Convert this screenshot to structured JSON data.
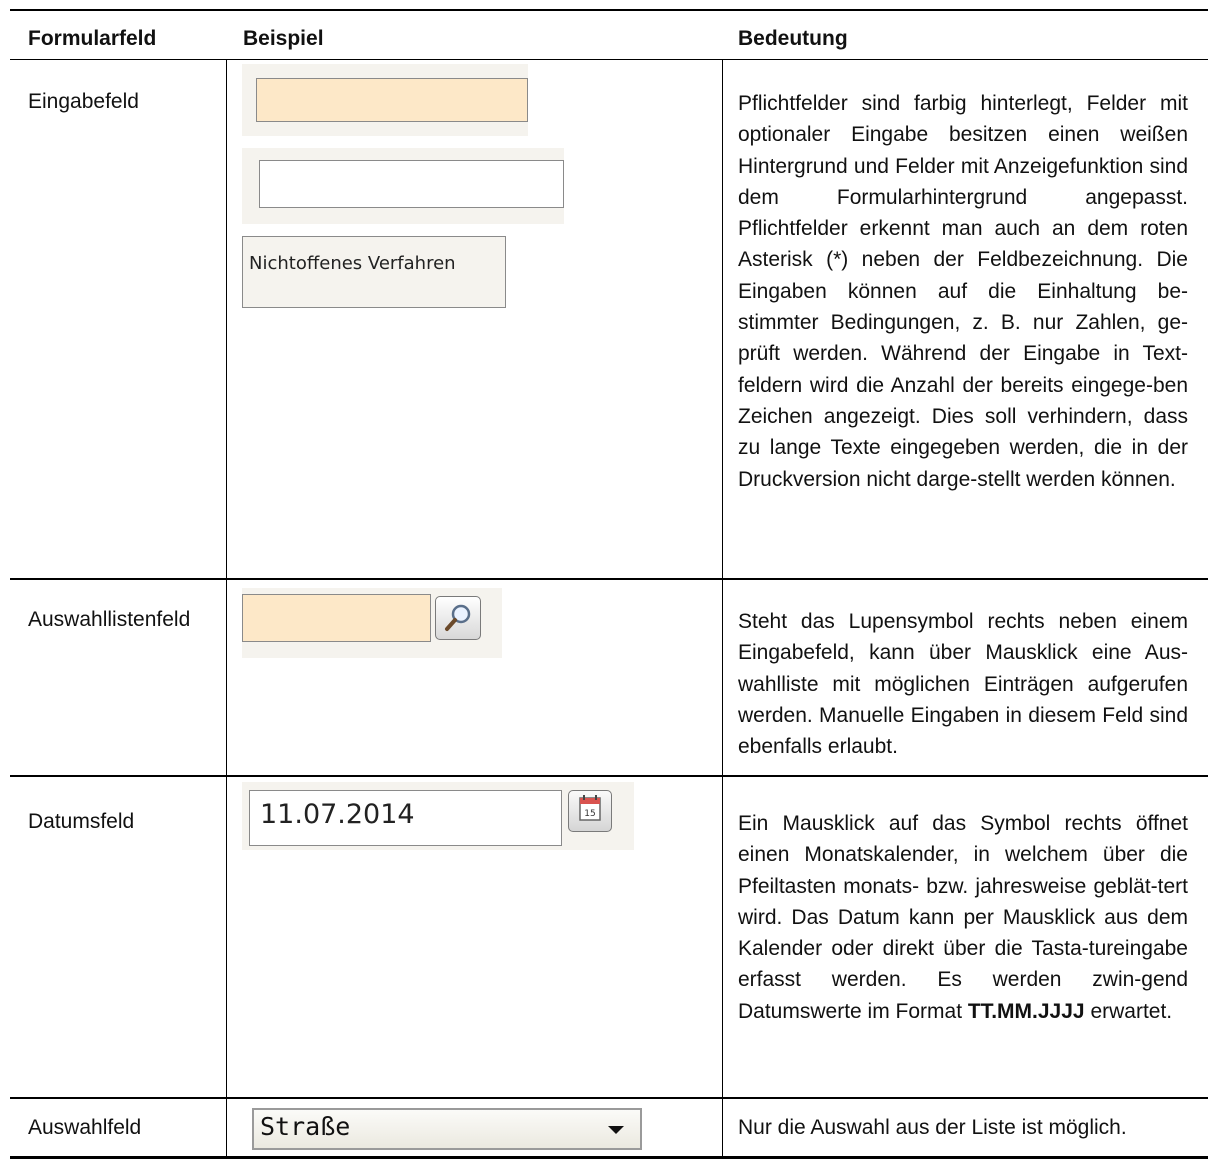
{
  "table": {
    "headers": {
      "field": "Formularfeld",
      "example": "Beispiel",
      "meaning": "Bedeutung"
    },
    "rows": [
      {
        "field": "Eingabefeld",
        "example_display_value": "Nichtoffenes Verfahren",
        "meaning": "Pflichtfelder sind farbig hinterlegt, Felder mit optionaler Eingabe besitzen einen weißen Hintergrund und Felder mit Anzeigefunktion sind dem Formularhintergrund angepasst. Pflichtfelder erkennt man auch an dem roten Asterisk (*) neben der Feldbezeichnung. Die Eingaben können auf die Einhaltung be-stimmter Bedingungen, z. B. nur Zahlen, ge-prüft werden. Während der Eingabe in Text-feldern wird die Anzahl der bereits eingege-ben Zeichen angezeigt. Dies soll verhindern, dass zu lange Texte eingegeben werden, die in der Druckversion nicht darge-stellt werden können."
      },
      {
        "field": "Auswahllistenfeld",
        "meaning": "Steht das Lupensymbol rechts neben einem Eingabefeld, kann über Mausklick eine Aus-wahlliste mit möglichen Einträgen aufgerufen werden. Manuelle Eingaben in diesem Feld sind ebenfalls erlaubt."
      },
      {
        "field": "Datumsfeld",
        "example_value": "11.07.2014",
        "calendar_day": "15",
        "meaning_before_bold": "Ein Mausklick auf das Symbol rechts öffnet einen Monatskalender, in welchem über die Pfeiltasten monats- bzw. jahresweise geblät-tert wird. Das Datum kann per Mausklick aus dem Kalender oder direkt über die Tasta-tureingabe erfasst werden. Es werden zwin-gend Datumswerte im Format",
        "meaning_bold": "TT.MM.JJJJ",
        "meaning_after_bold": "erwartet."
      },
      {
        "field": "Auswahlfeld",
        "example_selected": "Straße",
        "meaning": "Nur die Auswahl aus der Liste ist möglich."
      }
    ]
  },
  "colors": {
    "required_bg": "#fde8c8",
    "form_bg": "#f5f3ee"
  }
}
